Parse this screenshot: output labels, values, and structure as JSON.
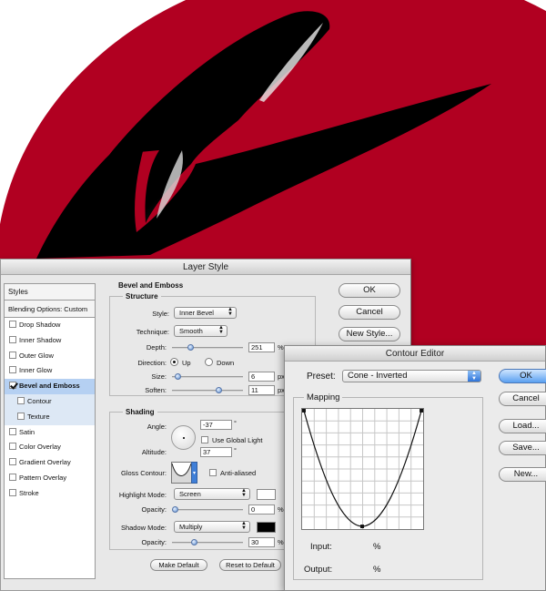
{
  "colors": {
    "artwork_red": "#b10021",
    "shape_black": "#000000",
    "highlight": "#ffffff",
    "selected_row": "#b5d0f2"
  },
  "layer_style": {
    "title": "Layer Style",
    "styles_header": "Styles",
    "blending_options": "Blending Options: Custom",
    "items": [
      {
        "label": "Drop Shadow",
        "checked": false
      },
      {
        "label": "Inner Shadow",
        "checked": false
      },
      {
        "label": "Outer Glow",
        "checked": false
      },
      {
        "label": "Inner Glow",
        "checked": false
      },
      {
        "label": "Bevel and Emboss",
        "checked": true,
        "selected": true
      },
      {
        "label": "Contour",
        "checked": false,
        "sub": true
      },
      {
        "label": "Texture",
        "checked": false,
        "sub": true
      },
      {
        "label": "Satin",
        "checked": false
      },
      {
        "label": "Color Overlay",
        "checked": false
      },
      {
        "label": "Gradient Overlay",
        "checked": false
      },
      {
        "label": "Pattern Overlay",
        "checked": false
      },
      {
        "label": "Stroke",
        "checked": false
      }
    ],
    "section_title": "Bevel and Emboss",
    "structure": {
      "title": "Structure",
      "style_label": "Style:",
      "style_value": "Inner Bevel",
      "technique_label": "Technique:",
      "technique_value": "Smooth",
      "depth_label": "Depth:",
      "depth_value": "251",
      "depth_unit": "%",
      "depth_slider": 0.25,
      "direction_label": "Direction:",
      "direction_up": "Up",
      "direction_down": "Down",
      "direction_selected": "Up",
      "size_label": "Size:",
      "size_value": "6",
      "size_unit": "px",
      "size_slider": 0.05,
      "soften_label": "Soften:",
      "soften_value": "11",
      "soften_unit": "px",
      "soften_slider": 0.7
    },
    "shading": {
      "title": "Shading",
      "angle_label": "Angle:",
      "angle_value": "-37",
      "angle_unit": "°",
      "global_light_label": "Use Global Light",
      "global_light_checked": false,
      "altitude_label": "Altitude:",
      "altitude_value": "37",
      "altitude_unit": "°",
      "gloss_label": "Gloss Contour:",
      "anti_aliased_label": "Anti-aliased",
      "anti_aliased_checked": false,
      "highlight_mode_label": "Highlight Mode:",
      "highlight_mode_value": "Screen",
      "highlight_color": "#ffffff",
      "highlight_opacity_label": "Opacity:",
      "highlight_opacity_value": "0",
      "highlight_opacity_unit": "%",
      "highlight_opacity_slider": 0.0,
      "shadow_mode_label": "Shadow Mode:",
      "shadow_mode_value": "Multiply",
      "shadow_color": "#000000",
      "shadow_opacity_label": "Opacity:",
      "shadow_opacity_value": "30",
      "shadow_opacity_unit": "%",
      "shadow_opacity_slider": 0.3
    },
    "make_default": "Make Default",
    "reset_default": "Reset to Default",
    "buttons": {
      "ok": "OK",
      "cancel": "Cancel",
      "new_style": "New Style..."
    }
  },
  "contour_editor": {
    "title": "Contour Editor",
    "preset_label": "Preset:",
    "preset_value": "Cone - Inverted",
    "mapping_label": "Mapping",
    "input_label": "Input:",
    "input_unit": "%",
    "output_label": "Output:",
    "output_unit": "%",
    "buttons": {
      "ok": "OK",
      "cancel": "Cancel",
      "load": "Load...",
      "save": "Save...",
      "new": "New..."
    }
  }
}
